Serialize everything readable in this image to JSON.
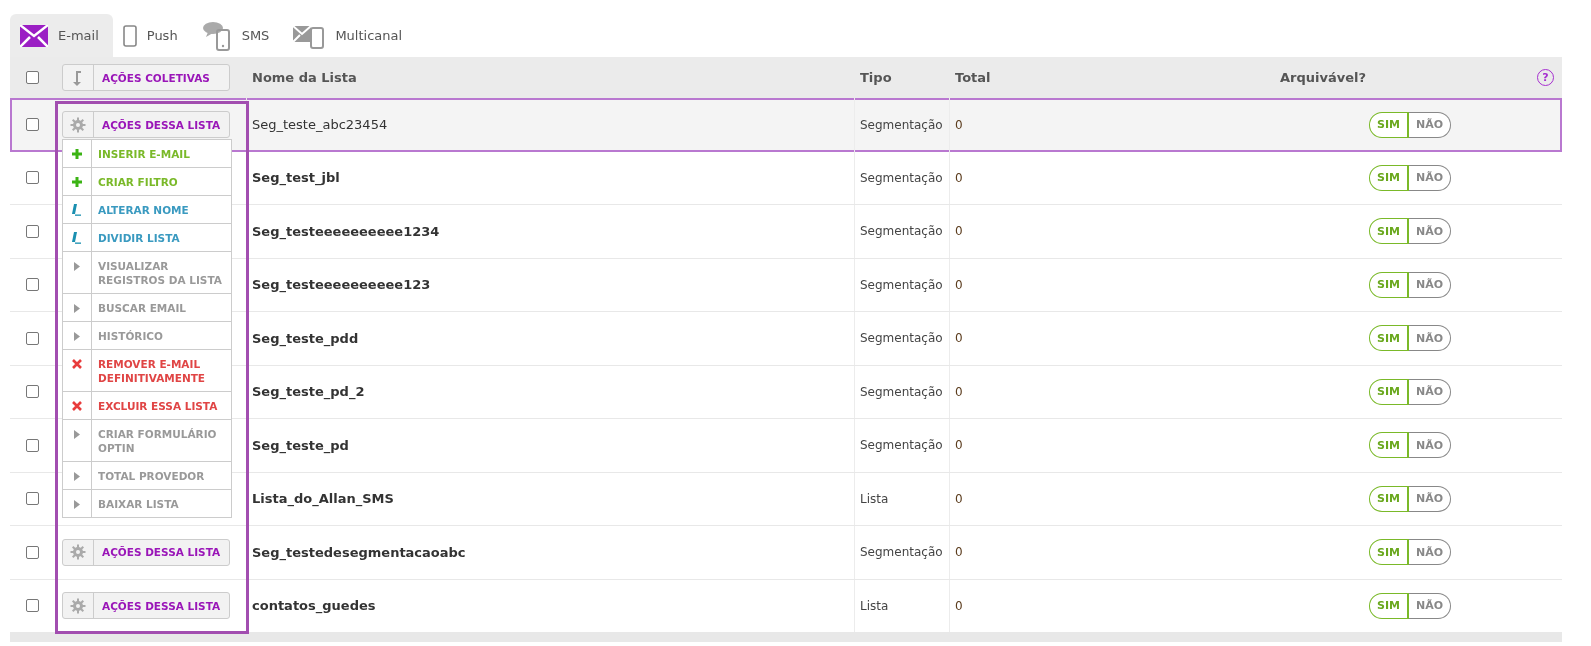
{
  "tabs": [
    {
      "label": "E-mail",
      "kind": "email",
      "selected": true
    },
    {
      "label": "Push",
      "kind": "push",
      "selected": false
    },
    {
      "label": "SMS",
      "kind": "sms",
      "selected": false
    },
    {
      "label": "Multicanal",
      "kind": "multi",
      "selected": false
    }
  ],
  "header": {
    "select_all": false,
    "bulk_button": "AÇÕES COLETIVAS",
    "columns": [
      "Nome da Lista",
      "Tipo",
      "Total",
      "Arquivável?"
    ],
    "help": "?"
  },
  "rows": [
    {
      "checked": false,
      "highlighted": true,
      "action_button": "AÇÕES DESSA LISTA",
      "name": "Seg_teste_abc23454",
      "type": "Segmentação",
      "total": "0",
      "archivable": true,
      "sim": "SIM",
      "nao": "NÃO"
    },
    {
      "checked": false,
      "highlighted": false,
      "name": "Seg_test_jbl",
      "type": "Segmentação",
      "total": "0",
      "archivable": true,
      "sim": "SIM",
      "nao": "NÃO"
    },
    {
      "checked": false,
      "highlighted": false,
      "name": "Seg_testeeeeeeeeee1234",
      "type": "Segmentação",
      "total": "0",
      "archivable": true,
      "sim": "SIM",
      "nao": "NÃO"
    },
    {
      "checked": false,
      "highlighted": false,
      "name": "Seg_testeeeeeeeeee123",
      "type": "Segmentação",
      "total": "0",
      "archivable": true,
      "sim": "SIM",
      "nao": "NÃO"
    },
    {
      "checked": false,
      "highlighted": false,
      "name": "Seg_teste_pdd",
      "type": "Segmentação",
      "total": "0",
      "archivable": true,
      "sim": "SIM",
      "nao": "NÃO"
    },
    {
      "checked": false,
      "highlighted": false,
      "name": "Seg_teste_pd_2",
      "type": "Segmentação",
      "total": "0",
      "archivable": true,
      "sim": "SIM",
      "nao": "NÃO"
    },
    {
      "checked": false,
      "highlighted": false,
      "name": "Seg_teste_pd",
      "type": "Segmentação",
      "total": "0",
      "archivable": true,
      "sim": "SIM",
      "nao": "NÃO"
    },
    {
      "checked": false,
      "highlighted": false,
      "name": "Lista_do_Allan_SMS",
      "type": "Lista",
      "total": "0",
      "archivable": true,
      "sim": "SIM",
      "nao": "NÃO"
    },
    {
      "checked": false,
      "highlighted": false,
      "action_button": "AÇÕES DESSA LISTA",
      "name": "Seg_testedesegmentacaoabc",
      "type": "Segmentação",
      "total": "0",
      "archivable": true,
      "sim": "SIM",
      "nao": "NÃO"
    },
    {
      "checked": false,
      "highlighted": false,
      "action_button": "AÇÕES DESSA LISTA",
      "name": "contatos_guedes",
      "type": "Lista",
      "total": "0",
      "archivable": true,
      "sim": "SIM",
      "nao": "NÃO"
    }
  ],
  "actions_menu": {
    "items": [
      {
        "label": "INSERIR E-MAIL",
        "kind": "add"
      },
      {
        "label": "CRIAR FILTRO",
        "kind": "add"
      },
      {
        "label": "ALTERAR NOME",
        "kind": "edit"
      },
      {
        "label": "DIVIDIR LISTA",
        "kind": "edit"
      },
      {
        "label": "VISUALIZAR REGISTROS DA LISTA",
        "kind": "view"
      },
      {
        "label": "BUSCAR EMAIL",
        "kind": "view"
      },
      {
        "label": "HISTÓRICO",
        "kind": "view"
      },
      {
        "label": "REMOVER E-MAIL DEFINITIVAMENTE",
        "kind": "delete"
      },
      {
        "label": "EXCLUIR ESSA LISTA",
        "kind": "delete"
      },
      {
        "label": "CRIAR FORMULÁRIO OPTIN",
        "kind": "view"
      },
      {
        "label": "TOTAL PROVEDOR",
        "kind": "view"
      },
      {
        "label": "BAIXAR LISTA",
        "kind": "view"
      }
    ]
  }
}
